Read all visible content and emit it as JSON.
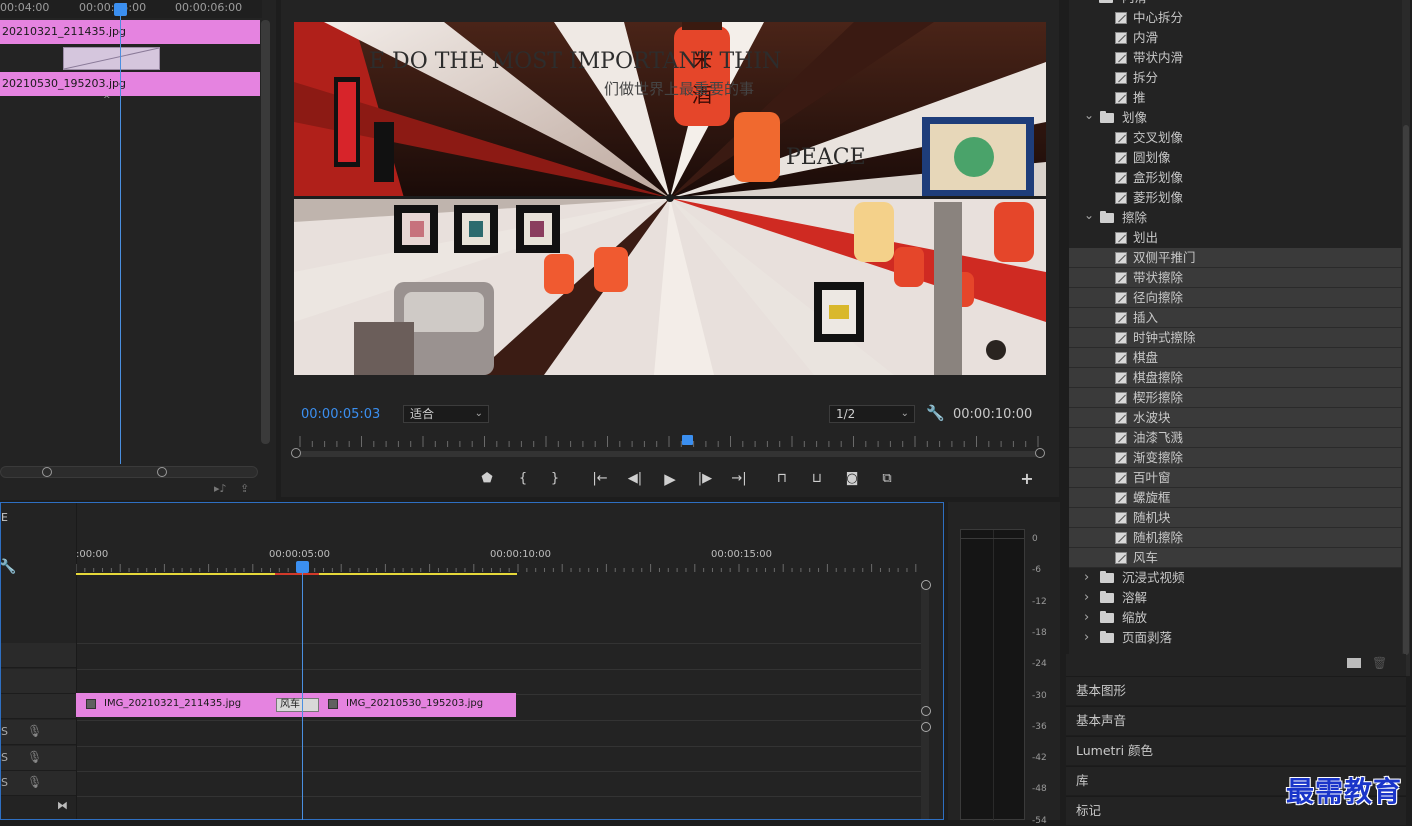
{
  "source": {
    "ruler": [
      "00:04:00",
      "00:00:05:00",
      "00:00:06:00"
    ],
    "clip_a": "20210321_211435.jpg",
    "clip_b": "20210530_195203.jpg"
  },
  "program": {
    "current_tc": "00:00:05:03",
    "fit": "适合",
    "resolution": "1/2",
    "duration_tc": "00:00:10:00",
    "scene_text_en": "E DO THE MOST IMPORTANT THIN",
    "scene_text_cn": "们做世界上最重要的事",
    "lantern_text": "米酒",
    "sign_text": "PEACE",
    "controls": [
      "marker",
      "in",
      "out",
      "goto-in",
      "step-back",
      "play",
      "step-fwd",
      "goto-out",
      "lift",
      "extract",
      "export-frame",
      "compare",
      "add"
    ]
  },
  "effects": {
    "top_folder": "内滑",
    "items": [
      {
        "type": "fx",
        "label": "中心拆分",
        "sel": false
      },
      {
        "type": "fx",
        "label": "内滑",
        "sel": false
      },
      {
        "type": "fx",
        "label": "带状内滑",
        "sel": false
      },
      {
        "type": "fx",
        "label": "拆分",
        "sel": false
      },
      {
        "type": "fx",
        "label": "推",
        "sel": false
      },
      {
        "type": "folder",
        "label": "划像",
        "open": true
      },
      {
        "type": "fx",
        "label": "交叉划像",
        "sel": false
      },
      {
        "type": "fx",
        "label": "圆划像",
        "sel": false
      },
      {
        "type": "fx",
        "label": "盒形划像",
        "sel": false
      },
      {
        "type": "fx",
        "label": "菱形划像",
        "sel": false
      },
      {
        "type": "folder",
        "label": "擦除",
        "open": true
      },
      {
        "type": "fx",
        "label": "划出",
        "sel": false
      },
      {
        "type": "fx",
        "label": "双侧平推门",
        "sel": true
      },
      {
        "type": "fx",
        "label": "带状擦除",
        "sel": true
      },
      {
        "type": "fx",
        "label": "径向擦除",
        "sel": true
      },
      {
        "type": "fx",
        "label": "插入",
        "sel": true
      },
      {
        "type": "fx",
        "label": "时钟式擦除",
        "sel": true
      },
      {
        "type": "fx",
        "label": "棋盘",
        "sel": true
      },
      {
        "type": "fx",
        "label": "棋盘擦除",
        "sel": true
      },
      {
        "type": "fx",
        "label": "楔形擦除",
        "sel": true
      },
      {
        "type": "fx",
        "label": "水波块",
        "sel": true
      },
      {
        "type": "fx",
        "label": "油漆飞溅",
        "sel": true
      },
      {
        "type": "fx",
        "label": "渐变擦除",
        "sel": true
      },
      {
        "type": "fx",
        "label": "百叶窗",
        "sel": true
      },
      {
        "type": "fx",
        "label": "螺旋框",
        "sel": true
      },
      {
        "type": "fx",
        "label": "随机块",
        "sel": true
      },
      {
        "type": "fx",
        "label": "随机擦除",
        "sel": true
      },
      {
        "type": "fx",
        "label": "风车",
        "sel": true
      },
      {
        "type": "folder",
        "label": "沉浸式视频",
        "open": false
      },
      {
        "type": "folder",
        "label": "溶解",
        "open": false
      },
      {
        "type": "folder",
        "label": "缩放",
        "open": false
      },
      {
        "type": "folder",
        "label": "页面剥落",
        "open": false
      }
    ]
  },
  "sections": [
    "基本图形",
    "基本声音",
    "Lumetri 颜色",
    "库",
    "标记"
  ],
  "timeline": {
    "ruler": [
      ":00:00",
      "00:00:05:00",
      "00:00:10:00",
      "00:00:15:00"
    ],
    "clip_a": "IMG_20210321_211435.jpg",
    "clip_b": "IMG_20210530_195203.jpg",
    "transition": "风车",
    "header_letter": "E",
    "track_labels": [
      "S",
      "S",
      "S"
    ]
  },
  "meter": {
    "db": [
      "0",
      "-6",
      "-12",
      "-18",
      "-24",
      "-30",
      "-36",
      "-42",
      "-48",
      "-54"
    ]
  },
  "watermark": "最需教育",
  "colors": {
    "clip": "#e583e0",
    "accent": "#3b8ff0",
    "work_area": "#e6d83a",
    "render_red": "#d23a2a"
  }
}
